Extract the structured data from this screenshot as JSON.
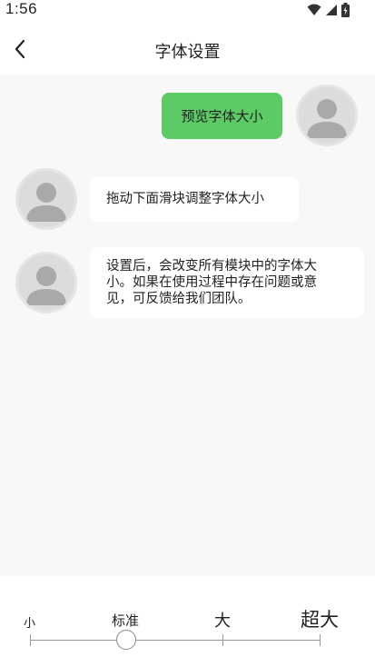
{
  "status": {
    "time": "1:56",
    "icons": [
      "wifi-icon",
      "signal-icon",
      "battery-icon"
    ]
  },
  "header": {
    "back_icon": "chevron-left-icon",
    "title": "字体设置"
  },
  "chat": {
    "messages": [
      {
        "side": "right",
        "text": "预览字体大小"
      },
      {
        "side": "left",
        "text": "拖动下面滑块调整字体大小"
      },
      {
        "side": "left",
        "line1": "设置后，会改变所有模块中的字体大",
        "line2": "小。如果在使用过程中存在问题或意",
        "line3": "见，可反馈给我们团队。"
      }
    ]
  },
  "font_size": {
    "labels": [
      "小",
      "标准",
      "大",
      "超大"
    ],
    "selected": "标准",
    "selected_index": 1,
    "steps": 4
  },
  "colors": {
    "accent_green": "#5ccb65",
    "chat_background": "#f8f8f8"
  }
}
